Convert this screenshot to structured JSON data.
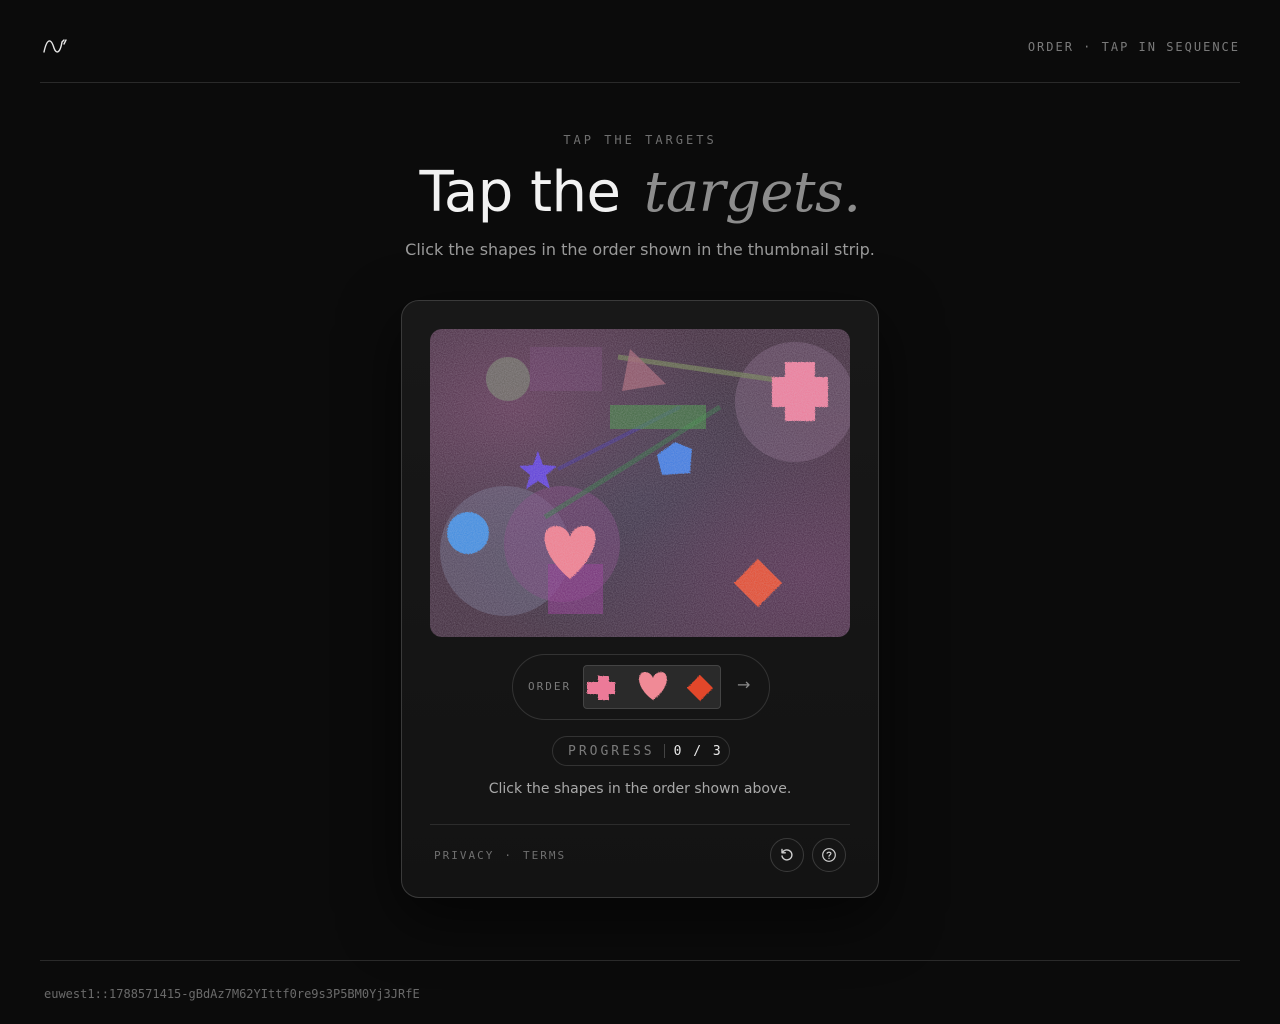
{
  "header": {
    "logo_icon": "wave-logo-icon",
    "mode_label": "ORDER · TAP IN SEQUENCE"
  },
  "hero": {
    "eyebrow": "TAP THE TARGETS",
    "title_plain": "Tap the",
    "title_emphasis": "targets.",
    "subtitle": "Click the shapes in the order shown in the thumbnail strip."
  },
  "challenge": {
    "canvas_shapes": [
      "pink-cross",
      "pink-heart",
      "red-diamond",
      "blue-pentagon",
      "blue-circle",
      "purple-star",
      "pink-triangle",
      "green-rectangle",
      "gray-circle"
    ],
    "order": {
      "label": "ORDER",
      "thumbnails": [
        "pink-cross",
        "pink-heart",
        "red-diamond"
      ],
      "arrow": "→"
    },
    "progress": {
      "label": "PROGRESS",
      "value": "0 / 3"
    },
    "instructions": "Click the shapes in the order shown above.",
    "links": {
      "privacy": "PRIVACY",
      "separator": "·",
      "terms": "TERMS"
    },
    "buttons": {
      "reload_icon": "reload-icon",
      "help_icon": "help-icon"
    }
  },
  "footer": {
    "session_id": "euwest1::1788571415-gBdAz7M62YIttf0re9s3P5BM0Yj3JRfE"
  },
  "colors": {
    "background": "#0b0b0b",
    "accent_pink": "#e8708e",
    "accent_red": "#e0452c",
    "accent_blue": "#3a78d8",
    "accent_purple": "#5a3bd0"
  }
}
